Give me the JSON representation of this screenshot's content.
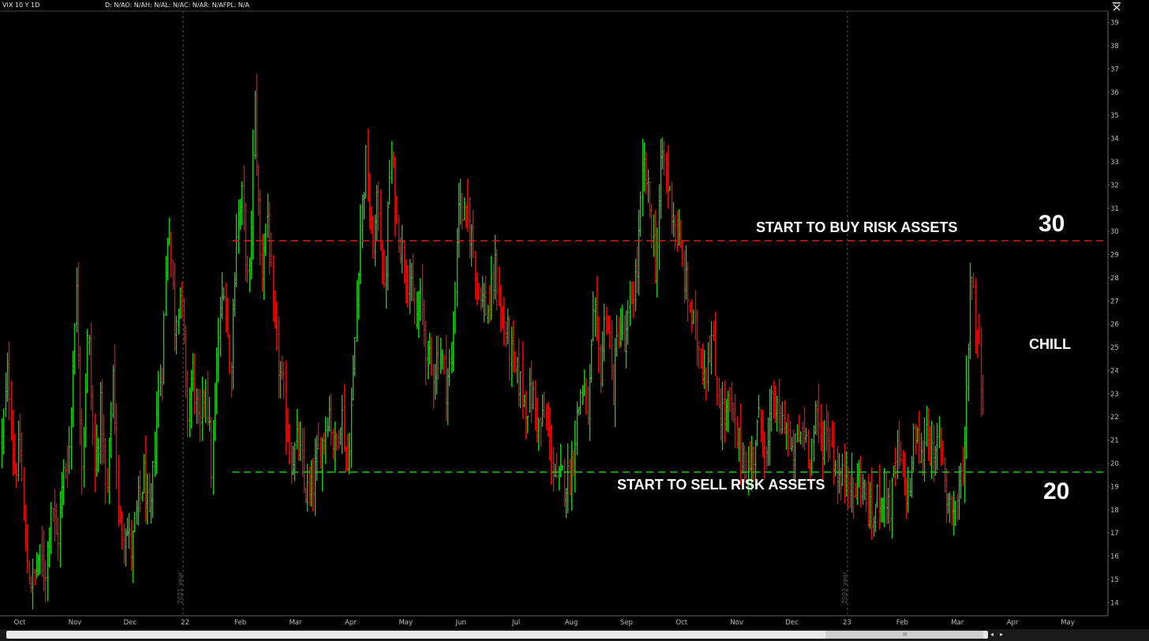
{
  "header": {
    "symbol_label": "VIX 10 Y 1D",
    "stats_label": "D: N/AO: N/AH: N/AL: N/AC: N/AR: N/AFPL: N/A"
  },
  "chart_data": {
    "type": "candlestick",
    "title": "VIX 10 Y 1D",
    "ylim": [
      13.5,
      39.5
    ],
    "y_ticks": [
      14,
      15,
      16,
      17,
      18,
      19,
      20,
      21,
      22,
      23,
      24,
      25,
      26,
      27,
      28,
      29,
      30,
      31,
      32,
      33,
      34,
      35,
      36,
      37,
      38,
      39
    ],
    "x_ticks": [
      "Oct",
      "Nov",
      "Dec",
      "22",
      "Feb",
      "Mar",
      "Apr",
      "May",
      "Jun",
      "Jul",
      "Aug",
      "Sep",
      "Oct",
      "Nov",
      "Dec",
      "23",
      "Feb",
      "Mar",
      "Apr",
      "May"
    ],
    "year_markers": [
      "2021 year",
      "2022 year"
    ],
    "grid": false,
    "up_color": "#1fcf1f",
    "down_color": "#e01010",
    "price_path": [
      [
        0,
        21
      ],
      [
        1,
        24
      ],
      [
        2,
        19.8
      ],
      [
        3,
        20.5
      ],
      [
        4,
        15.5
      ],
      [
        5,
        14.8
      ],
      [
        6,
        16
      ],
      [
        7,
        15.2
      ],
      [
        8,
        18.5
      ],
      [
        9,
        16.5
      ],
      [
        10,
        19.5
      ],
      [
        11,
        20.8
      ],
      [
        12,
        28
      ],
      [
        13,
        20
      ],
      [
        14,
        26
      ],
      [
        15,
        19.5
      ],
      [
        16,
        22.5
      ],
      [
        17,
        18
      ],
      [
        18,
        24
      ],
      [
        19,
        17
      ],
      [
        20,
        17.5
      ],
      [
        21,
        16.2
      ],
      [
        22,
        18
      ],
      [
        23,
        19.5
      ],
      [
        24,
        17
      ],
      [
        25,
        22
      ],
      [
        26,
        24.5
      ],
      [
        27,
        31
      ],
      [
        28,
        26
      ],
      [
        29,
        27.8
      ],
      [
        30,
        22
      ],
      [
        31,
        24
      ],
      [
        32,
        21
      ],
      [
        33,
        24
      ],
      [
        34,
        19.5
      ],
      [
        35,
        25
      ],
      [
        36,
        28
      ],
      [
        37,
        23.5
      ],
      [
        38,
        30
      ],
      [
        39,
        31.5
      ],
      [
        40,
        27
      ],
      [
        41,
        35.5
      ],
      [
        42,
        28
      ],
      [
        43,
        31
      ],
      [
        44,
        26
      ],
      [
        45,
        24
      ],
      [
        46,
        22
      ],
      [
        47,
        20
      ],
      [
        48,
        21
      ],
      [
        49,
        19
      ],
      [
        50,
        18.5
      ],
      [
        51,
        20
      ],
      [
        52,
        21
      ],
      [
        53,
        22.5
      ],
      [
        54,
        20.5
      ],
      [
        55,
        22.5
      ],
      [
        56,
        19.6
      ],
      [
        57,
        24
      ],
      [
        58,
        30
      ],
      [
        59,
        33
      ],
      [
        60,
        29
      ],
      [
        61,
        31.5
      ],
      [
        62,
        27
      ],
      [
        63,
        33.5
      ],
      [
        64,
        30.5
      ],
      [
        65,
        29
      ],
      [
        66,
        28
      ],
      [
        67,
        26
      ],
      [
        68,
        27
      ],
      [
        69,
        24.5
      ],
      [
        70,
        24
      ],
      [
        71,
        25
      ],
      [
        72,
        23.5
      ],
      [
        73,
        24.5
      ],
      [
        74,
        31.5
      ],
      [
        75,
        30.5
      ],
      [
        76,
        30
      ],
      [
        77,
        28
      ],
      [
        78,
        27
      ],
      [
        79,
        26.5
      ],
      [
        80,
        28.5
      ],
      [
        81,
        26
      ],
      [
        82,
        25.5
      ],
      [
        83,
        24
      ],
      [
        84,
        23.5
      ],
      [
        85,
        22.5
      ],
      [
        86,
        23
      ],
      [
        87,
        21.5
      ],
      [
        88,
        22
      ],
      [
        89,
        20.5
      ],
      [
        90,
        19
      ],
      [
        91,
        19.5
      ],
      [
        92,
        19.3
      ],
      [
        93,
        21.5
      ],
      [
        94,
        23.5
      ],
      [
        95,
        22
      ],
      [
        96,
        26.5
      ],
      [
        97,
        24
      ],
      [
        98,
        27
      ],
      [
        99,
        23
      ],
      [
        100,
        26
      ],
      [
        101,
        25
      ],
      [
        102,
        27
      ],
      [
        103,
        28.5
      ],
      [
        104,
        33
      ],
      [
        105,
        31
      ],
      [
        106,
        28.5
      ],
      [
        107,
        33.5
      ],
      [
        108,
        32
      ],
      [
        109,
        30.5
      ],
      [
        110,
        29
      ],
      [
        111,
        27.5
      ],
      [
        112,
        26
      ],
      [
        113,
        25
      ],
      [
        114,
        24
      ],
      [
        115,
        25.5
      ],
      [
        116,
        23
      ],
      [
        117,
        22
      ],
      [
        118,
        22.5
      ],
      [
        119,
        21
      ],
      [
        120,
        20.5
      ],
      [
        121,
        19.5
      ],
      [
        122,
        21
      ],
      [
        123,
        22
      ],
      [
        124,
        20
      ],
      [
        125,
        23
      ],
      [
        126,
        21.5
      ],
      [
        127,
        22
      ],
      [
        128,
        20
      ],
      [
        129,
        21
      ],
      [
        130,
        21.5
      ],
      [
        131,
        20.5
      ],
      [
        132,
        22
      ],
      [
        133,
        21
      ],
      [
        134,
        21.5
      ],
      [
        135,
        20
      ],
      [
        136,
        19
      ],
      [
        137,
        20
      ],
      [
        138,
        18.5
      ],
      [
        139,
        19.5
      ],
      [
        140,
        18.5
      ],
      [
        141,
        17.5
      ],
      [
        142,
        18.5
      ],
      [
        143,
        19
      ],
      [
        144,
        18
      ],
      [
        145,
        20.5
      ],
      [
        146,
        19.5
      ],
      [
        147,
        18.5
      ],
      [
        148,
        21.5
      ],
      [
        149,
        20
      ],
      [
        150,
        22
      ],
      [
        151,
        19.5
      ],
      [
        152,
        21.5
      ],
      [
        153,
        19
      ],
      [
        154,
        18
      ],
      [
        155,
        18.3
      ],
      [
        156,
        20.5
      ],
      [
        157,
        28.5
      ],
      [
        158,
        26
      ],
      [
        159,
        23
      ]
    ]
  },
  "annotations": {
    "buy_label": "START TO BUY RISK ASSETS",
    "sell_label": "START TO SELL RISK ASSETS",
    "middle_label": "CHILL",
    "upper_level": "30",
    "lower_level": "20"
  },
  "levels": {
    "upper_line_value": 29.5,
    "lower_line_value": 19.5
  },
  "colors": {
    "upper_line": "#d42020",
    "lower_line": "#22c022",
    "background": "#000000"
  }
}
